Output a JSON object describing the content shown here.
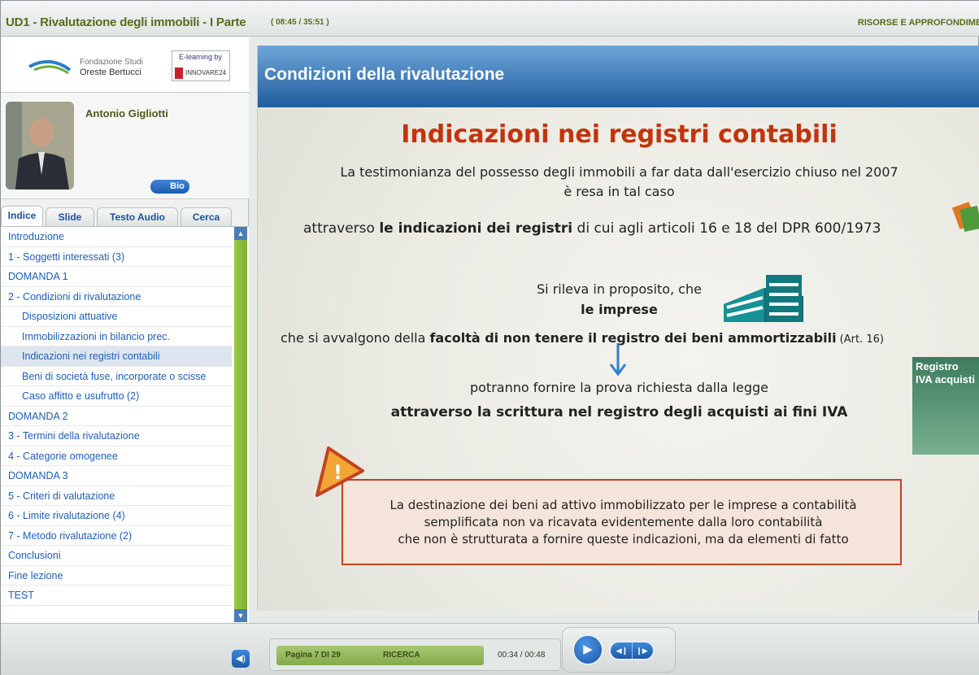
{
  "topbar": {
    "course_title": "UD1 - Rivalutazione degli immobili - I Parte",
    "time": "( 08:45 / 35:51 )",
    "resources_label": "RISORSE E APPROFONDIMENTI"
  },
  "brand": {
    "line1": "Fondazione Studi",
    "line2": "Oreste Bertucci",
    "partner_top": "E-learning by",
    "partner_bottom": "INNOVARE24"
  },
  "speaker": {
    "name": "Antonio Gigliotti",
    "bio_label": "Bio"
  },
  "tabs": [
    "Indice",
    "Slide",
    "Testo Audio",
    "Cerca"
  ],
  "index": [
    {
      "label": "Introduzione",
      "indent": 0
    },
    {
      "label": "1 - Soggetti interessati (3)",
      "indent": 0
    },
    {
      "label": "DOMANDA 1",
      "indent": 0
    },
    {
      "label": "2 - Condizioni di rivalutazione",
      "indent": 0
    },
    {
      "label": "Disposizioni attuative",
      "indent": 1
    },
    {
      "label": "Immobilizzazioni in bilancio prec.",
      "indent": 1
    },
    {
      "label": "Indicazioni nei registri contabili",
      "indent": 1,
      "selected": true
    },
    {
      "label": "Beni di società fuse, incorporate o scisse",
      "indent": 1
    },
    {
      "label": "Caso affitto e usufrutto (2)",
      "indent": 1
    },
    {
      "label": "DOMANDA 2",
      "indent": 0
    },
    {
      "label": "3 - Termini della rivalutazione",
      "indent": 0
    },
    {
      "label": "4 - Categorie omogenee",
      "indent": 0
    },
    {
      "label": "DOMANDA 3",
      "indent": 0
    },
    {
      "label": "5 - Criteri di valutazione",
      "indent": 0
    },
    {
      "label": "6 - Limite rivalutazione (4)",
      "indent": 0
    },
    {
      "label": "7 - Metodo rivalutazione (2)",
      "indent": 0
    },
    {
      "label": "Conclusioni",
      "indent": 0
    },
    {
      "label": "Fine lezione",
      "indent": 0
    },
    {
      "label": "TEST",
      "indent": 0
    }
  ],
  "slide": {
    "header_title": "Condizioni della rivalutazione",
    "heading": "Indicazioni nei registri contabili",
    "p1_line1": "La testimonianza del possesso degli immobili a far data dall'esercizio chiuso nel 2007",
    "p1_line2": "è resa in tal caso",
    "p2_pre": "attraverso ",
    "p2_bold": "le indicazioni dei registri",
    "p2_post": " di cui agli articoli 16 e 18 del DPR 600/1973",
    "p3": "Si rileva in proposito, che",
    "p4": "le imprese",
    "p5_pre": "che si avvalgono della ",
    "p5_bold": "facoltà di non tenere il registro dei beni ammortizzabili",
    "p5_post": " (Art. 16)",
    "p6": "potranno fornire la prova richiesta dalla legge",
    "p7": "attraverso la scrittura nel registro degli acquisti ai fini IVA",
    "registro_line1": "Registro",
    "registro_line2": "IVA acquisti",
    "note_line1": "La destinazione dei beni ad attivo immobilizzato per le imprese a contabilità",
    "note_line2": "semplificata non va ricavata evidentemente dalla loro contabilità",
    "note_line3": "che non è strutturata a fornire queste indicazioni, ma da elementi di fatto"
  },
  "player": {
    "page": "Pagina 7 DI 29",
    "search_label": "RICERCA",
    "time": "00:34 / 00:48"
  },
  "colors": {
    "accent_blue": "#1c5cae",
    "heading_red": "#c2340c",
    "title_olive": "#5a6b1c",
    "scroll_green": "#7fb02d"
  }
}
